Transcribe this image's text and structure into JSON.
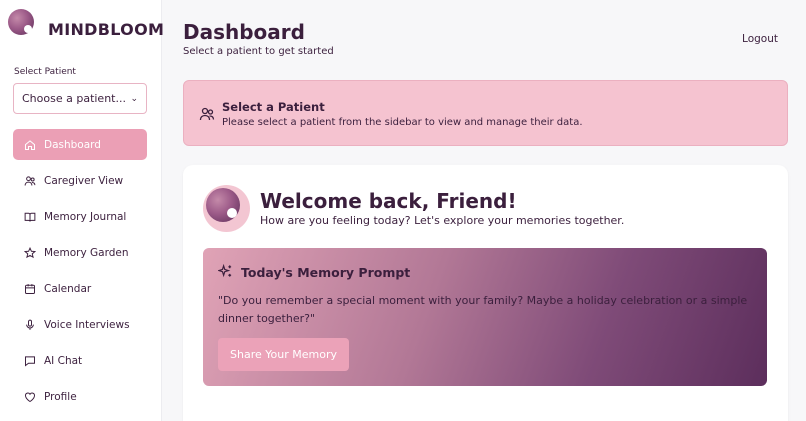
{
  "brand": {
    "name": "MINDBLOOM"
  },
  "sidebar": {
    "select_label": "Select Patient",
    "select_value": "Choose a patient...",
    "items": [
      {
        "label": "Dashboard",
        "icon": "home-icon",
        "active": true
      },
      {
        "label": "Caregiver View",
        "icon": "people-icon"
      },
      {
        "label": "Memory Journal",
        "icon": "book-icon"
      },
      {
        "label": "Memory Garden",
        "icon": "star-icon"
      },
      {
        "label": "Calendar",
        "icon": "calendar-icon"
      },
      {
        "label": "Voice Interviews",
        "icon": "microphone-icon"
      },
      {
        "label": "AI Chat",
        "icon": "chat-icon"
      },
      {
        "label": "Profile",
        "icon": "heart-icon"
      }
    ]
  },
  "header": {
    "title": "Dashboard",
    "subtitle": "Select a patient to get started",
    "logout": "Logout"
  },
  "alert": {
    "title": "Select a Patient",
    "text": "Please select a patient from the sidebar to view and manage their data."
  },
  "welcome": {
    "title": "Welcome back, Friend!",
    "subtitle": "How are you feeling today? Let's explore your memories together."
  },
  "prompt": {
    "title": "Today's Memory Prompt",
    "text": "\"Do you remember a special moment with your family? Maybe a holiday celebration or a simple dinner together?\"",
    "button": "Share Your Memory"
  },
  "colors": {
    "accent": "#eb9fb5",
    "alert_bg": "#f5c3d0",
    "text": "#3b1f3d",
    "gradient_end": "#5c2e5c"
  }
}
